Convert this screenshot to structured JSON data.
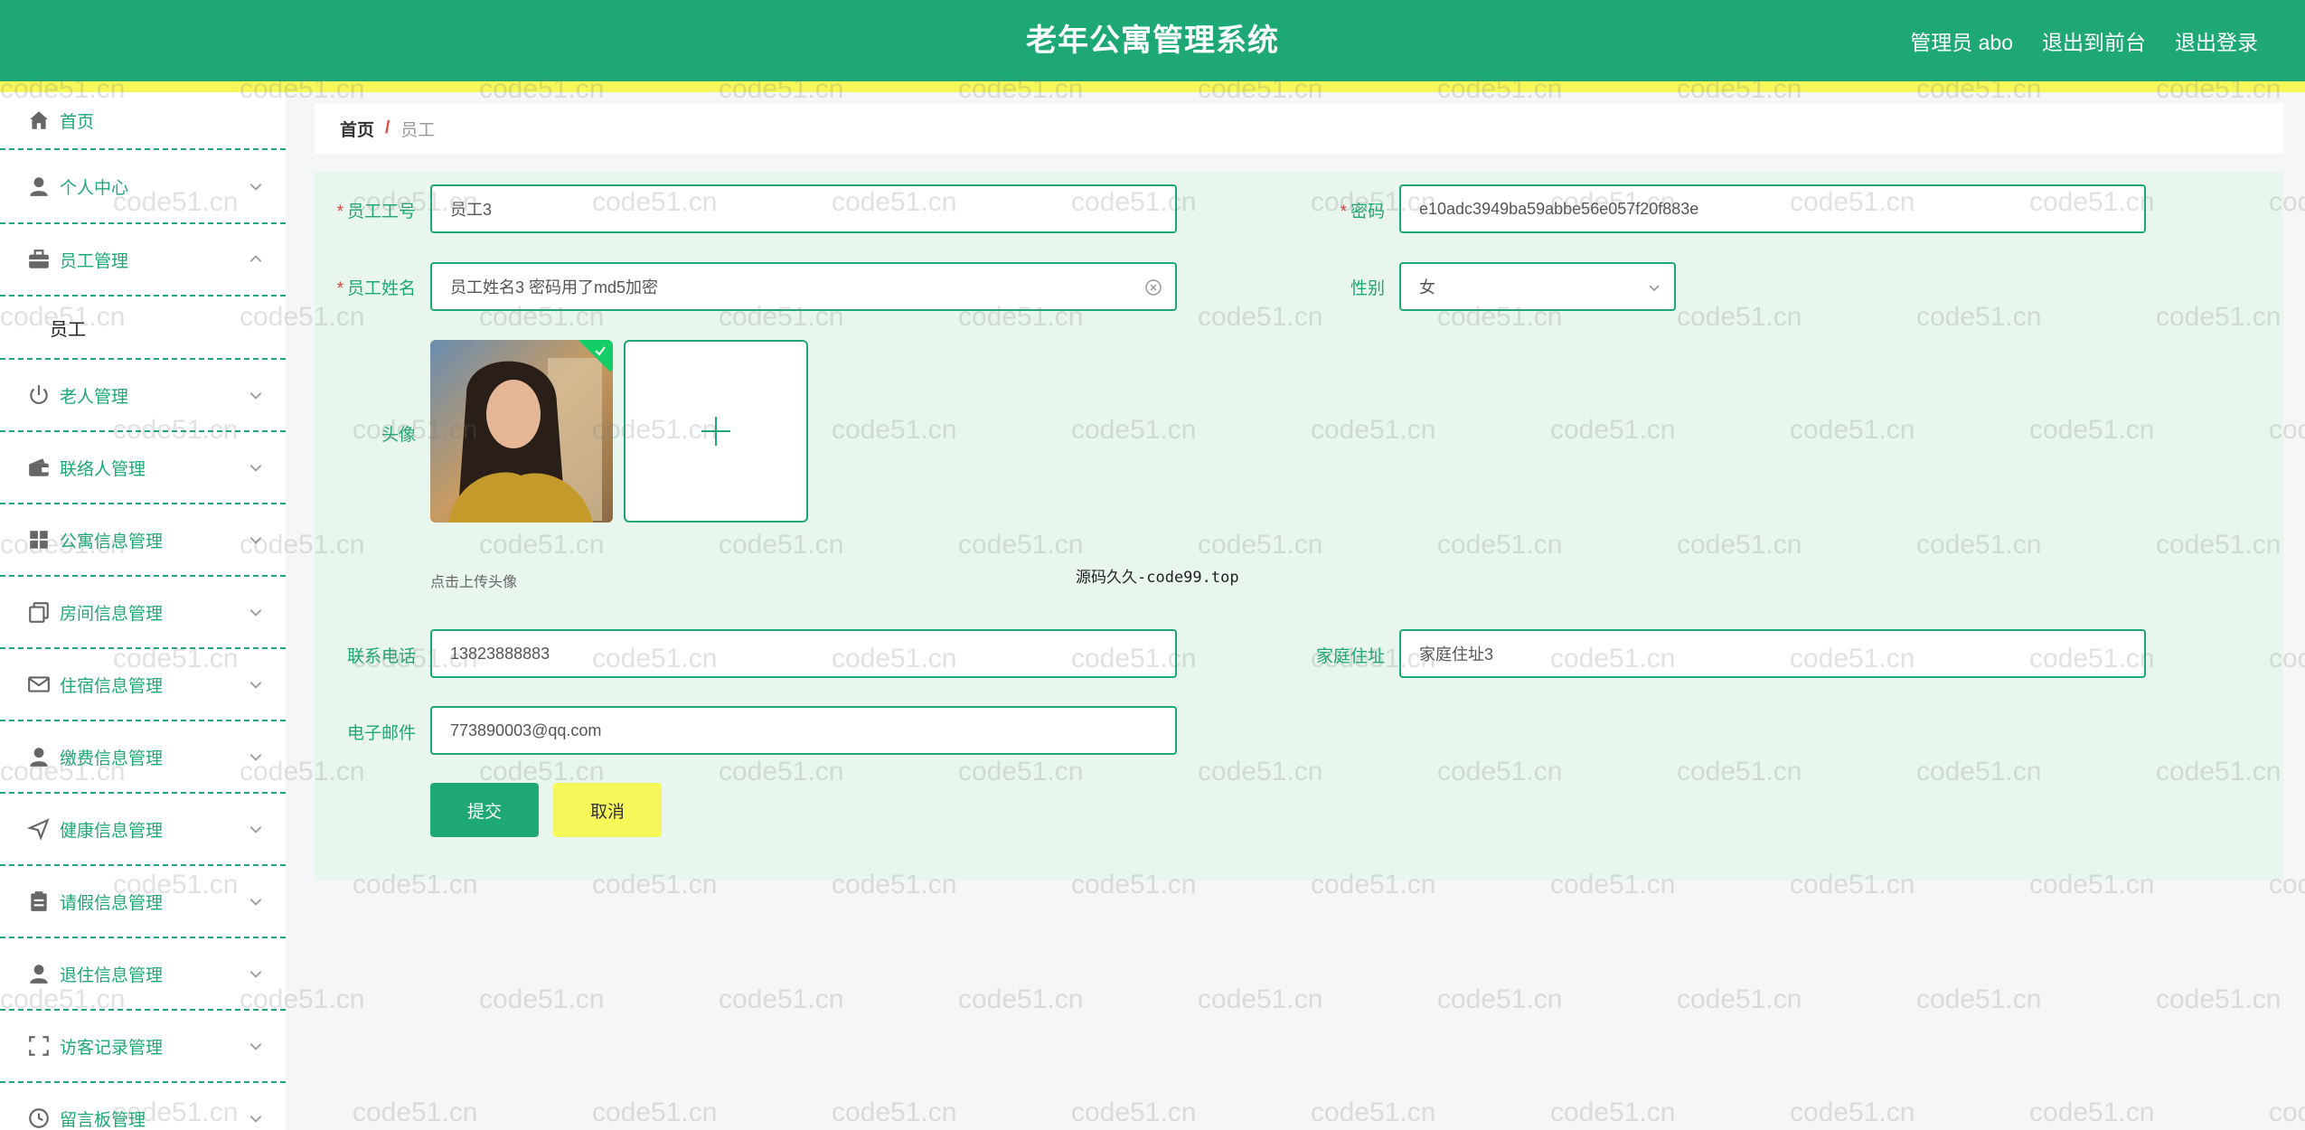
{
  "header": {
    "app_title": "老年公寓管理系统",
    "admin_label": "管理员 abo",
    "frontend_link": "退出到前台",
    "logout_link": "退出登录",
    "bar_color": "#1ea876",
    "stripe_color": "#f6f85a"
  },
  "sidebar": {
    "items": [
      {
        "label": "首页",
        "icon": "home-icon"
      },
      {
        "label": "个人中心",
        "icon": "user-icon"
      },
      {
        "label": "员工管理",
        "icon": "briefcase-icon"
      },
      {
        "label": "员工",
        "icon": ""
      },
      {
        "label": "老人管理",
        "icon": "power-icon"
      },
      {
        "label": "联络人管理",
        "icon": "wallet-icon"
      },
      {
        "label": "公寓信息管理",
        "icon": "grid-icon"
      },
      {
        "label": "房间信息管理",
        "icon": "copy-icon"
      },
      {
        "label": "住宿信息管理",
        "icon": "mail-icon"
      },
      {
        "label": "缴费信息管理",
        "icon": "user-icon"
      },
      {
        "label": "健康信息管理",
        "icon": "send-icon"
      },
      {
        "label": "请假信息管理",
        "icon": "clipboard-icon"
      },
      {
        "label": "退住信息管理",
        "icon": "user-icon"
      },
      {
        "label": "访客记录管理",
        "icon": "scan-icon"
      },
      {
        "label": "留言板管理",
        "icon": "clock-icon"
      }
    ]
  },
  "breadcrumb": {
    "home": "首页",
    "separator": "/",
    "current": "员工"
  },
  "form": {
    "emp_no_label": "员工工号",
    "emp_no_value": "员工3",
    "password_label": "密码",
    "password_value": "e10adc3949ba59abbe56e057f20f883e",
    "emp_name_label": "员工姓名",
    "emp_name_value": "员工姓名3 密码用了md5加密",
    "gender_label": "性别",
    "gender_value": "女",
    "avatar_label": "头像",
    "upload_hint": "点击上传头像",
    "phone_label": "联系电话",
    "phone_value": "13823888883",
    "address_label": "家庭住址",
    "address_value": "家庭住址3",
    "email_label": "电子邮件",
    "email_value": "773890003@qq.com",
    "submit_label": "提交",
    "cancel_label": "取消",
    "required_mark": "*"
  },
  "credit_text": "源码久久-code99.top",
  "watermark_text": "code51.cn"
}
